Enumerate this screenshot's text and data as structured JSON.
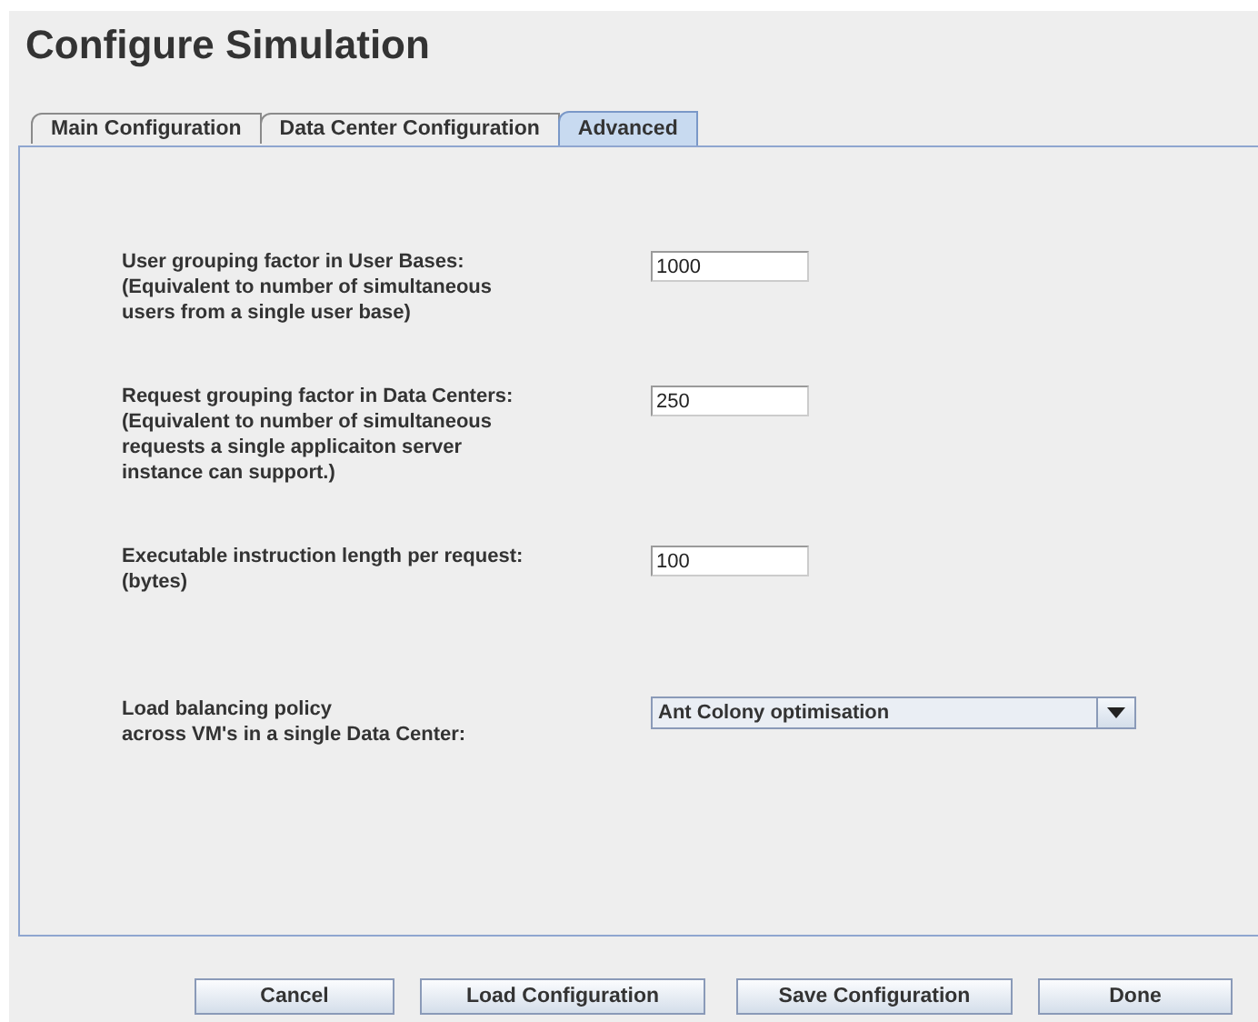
{
  "window": {
    "title": "Configure Simulation"
  },
  "tabs": [
    {
      "label": "Main Configuration",
      "selected": false
    },
    {
      "label": "Data Center Configuration",
      "selected": false
    },
    {
      "label": "Advanced",
      "selected": true
    }
  ],
  "settings": [
    {
      "kind": "text",
      "label": "User grouping factor in User Bases:\n(Equivalent to number of simultaneous\nusers from a single user base)",
      "value": "1000"
    },
    {
      "kind": "text",
      "label": "Request grouping factor in Data Centers:\n(Equivalent to number of simultaneous\nrequests a single applicaiton server\ninstance can support.)",
      "value": "250"
    },
    {
      "kind": "text",
      "label": "Executable instruction length per request:\n(bytes)",
      "value": "100"
    },
    {
      "kind": "select",
      "label": "Load balancing policy\nacross VM's in a single Data Center:",
      "value": "Ant Colony optimisation"
    }
  ],
  "buttons": [
    "Cancel",
    "Load Configuration",
    "Save Configuration",
    "Done"
  ]
}
